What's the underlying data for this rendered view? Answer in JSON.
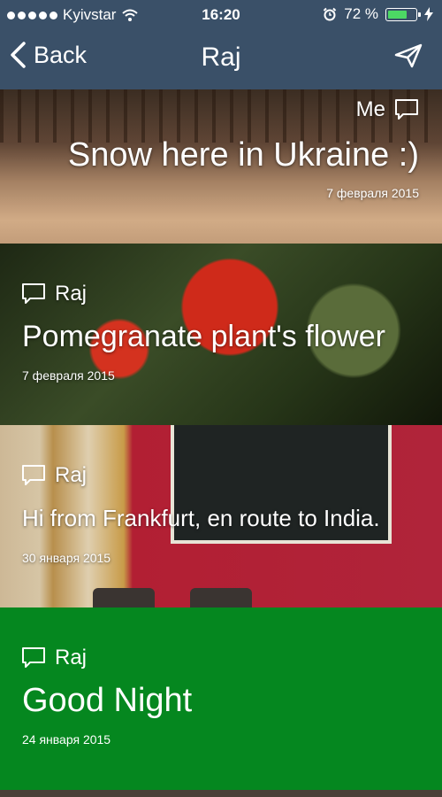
{
  "status_bar": {
    "carrier": "Kyivstar",
    "time": "16:20",
    "battery_percent": "72 %",
    "battery_level": 0.72
  },
  "nav": {
    "back_label": "Back",
    "title": "Raj",
    "send_icon": "paper-plane-icon"
  },
  "posts": [
    {
      "author": "Me",
      "text": "Snow here in Ukraine :)",
      "date": "7 февраля 2015"
    },
    {
      "author": "Raj",
      "text": "Pomegranate plant's flower",
      "date": "7 февраля 2015"
    },
    {
      "author": "Raj",
      "text": "Hi from Frankfurt, en route to India.",
      "date": "30 января 2015"
    },
    {
      "author": "Raj",
      "text": "Good Night",
      "date": "24 января 2015"
    }
  ],
  "colors": {
    "nav_background": "#3a5068",
    "green_card": "#05871f",
    "battery": "#4cd964"
  }
}
